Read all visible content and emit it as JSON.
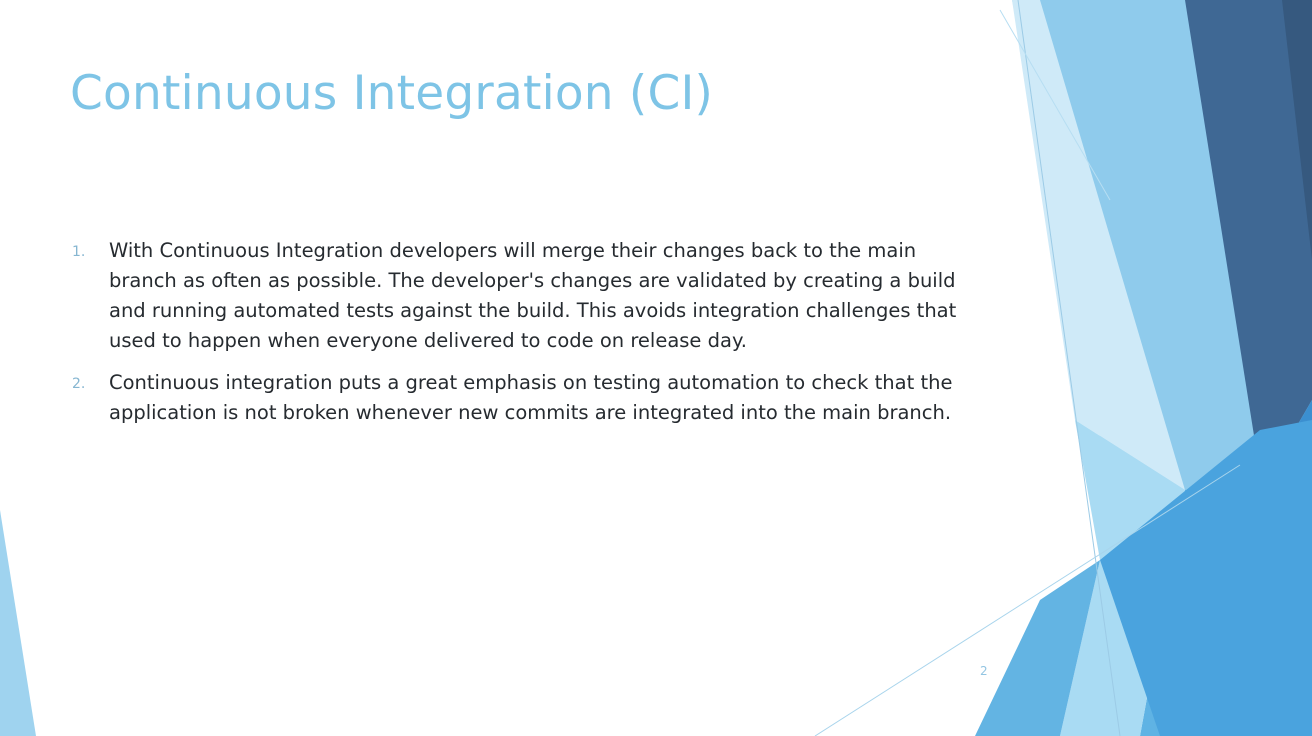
{
  "slide": {
    "title": "Continuous Integration (CI)",
    "items": [
      {
        "number": "1.",
        "text": "With Continuous Integration developers will merge their changes back to the main branch as often as possible. The developer's changes are validated by creating a build and running automated tests against the build. This avoids integration challenges that used to happen when everyone delivered to code on release day."
      },
      {
        "number": "2.",
        "text": "Continuous integration puts a great emphasis on testing automation to check that the application is not broken whenever new commits are integrated into the main branch."
      }
    ],
    "page_number": "2"
  },
  "colors": {
    "title": "#7ec4e6",
    "body_text": "#262b30",
    "list_number": "#86b6d1",
    "facet_light": "#a9d9f2",
    "facet_mid": "#6fbde6",
    "facet_strong": "#3d9ad6",
    "facet_dark": "#3f6894"
  }
}
